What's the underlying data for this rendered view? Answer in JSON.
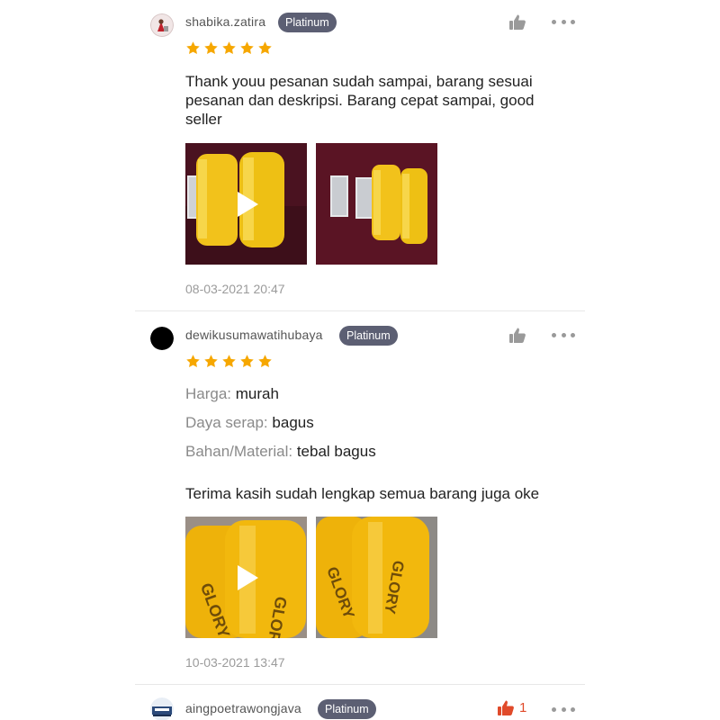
{
  "reviews": [
    {
      "username": "shabika.zatira",
      "badge": "Platinum",
      "rating": 5,
      "text": "Thank youu pesanan sudah sampai, barang sesuai pesanan dan deskripsi. Barang cepat sampai, good seller",
      "media": [
        "video",
        "photo"
      ],
      "date": "08-03-2021 20:47",
      "liked": false,
      "icons": [
        "thumbs-up-icon",
        "more-icon",
        "play-icon"
      ]
    },
    {
      "username": "dewikusumawatihubaya",
      "badge": "Platinum",
      "rating": 5,
      "attributes": [
        {
          "key": "Harga:",
          "value": "murah"
        },
        {
          "key": "Daya serap:",
          "value": "bagus"
        },
        {
          "key": "Bahan/Material:",
          "value": "tebal bagus"
        }
      ],
      "text": "Terima kasih sudah lengkap semua barang juga oke",
      "media": [
        "video",
        "photo"
      ],
      "date": "10-03-2021 13:47",
      "liked": false
    },
    {
      "username": "aingpoetrawongjava",
      "badge": "Platinum",
      "liked": true,
      "like_count": "1"
    }
  ],
  "colors": {
    "star": "#f6a700",
    "badge_bg": "#5c5f73",
    "like_active": "#e04a2a",
    "product_yellow": "#f2c21b"
  }
}
